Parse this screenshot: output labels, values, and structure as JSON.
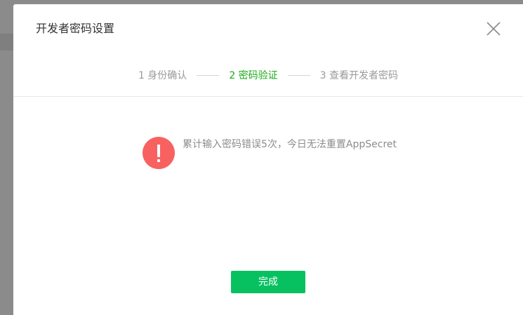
{
  "dialog": {
    "title": "开发者密码设置",
    "close_icon": "close-icon"
  },
  "stepper": {
    "steps": [
      {
        "label": "1 身份确认",
        "state": "done"
      },
      {
        "label": "2 密码验证",
        "state": "active"
      },
      {
        "label": "3 查看开发者密码",
        "state": "pending"
      }
    ],
    "active_color": "#1aad19",
    "inactive_color": "#9a9a9a"
  },
  "message": {
    "icon": "error-icon",
    "icon_color": "#f76260",
    "text": "累计输入密码错误5次，今日无法重置AppSecret"
  },
  "actions": {
    "done_label": "完成",
    "done_color": "#07c160"
  }
}
